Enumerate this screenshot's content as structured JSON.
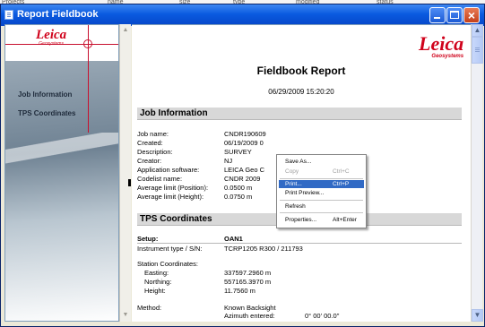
{
  "background_window": {
    "texts": [
      "Projects",
      "name",
      "size",
      "type",
      "modified",
      "status"
    ]
  },
  "window": {
    "title": "Report Fieldbook"
  },
  "left_pane": {
    "logo": {
      "word": "Leica",
      "sub": "Geosystems"
    },
    "links": [
      "Job Information",
      "TPS Coordinates"
    ]
  },
  "report": {
    "logo": {
      "word": "Leica",
      "sub": "Geosystems"
    },
    "title": "Fieldbook Report",
    "datetime": "06/29/2009 15:20:20",
    "job_section": {
      "heading": "Job Information",
      "rows": [
        {
          "label": "Job name:",
          "value": "CNDR190609"
        },
        {
          "label": "Created:",
          "value": "06/19/2009 0"
        },
        {
          "label": "Description:",
          "value": "SURVEY"
        },
        {
          "label": "Creator:",
          "value": "NJ"
        },
        {
          "label": "Application software:",
          "value": "LEICA Geo C"
        },
        {
          "label": "Codelist name:",
          "value": "CNDR 2009"
        },
        {
          "label": "Average limit (Position):",
          "value": "0.0500 m"
        },
        {
          "label": "Average limit (Height):",
          "value": "0.0750 m"
        }
      ]
    },
    "tps_section": {
      "heading": "TPS Coordinates",
      "setup_label": "Setup:",
      "setup_value": "OAN1",
      "instrument_label": "Instrument type / S/N:",
      "instrument_value": "TCRP1205 R300 / 211793",
      "station_label": "Station Coordinates:",
      "coords": [
        {
          "label": "Easting:",
          "value": "337597.2960 m"
        },
        {
          "label": "Northing:",
          "value": "557165.3970 m"
        },
        {
          "label": "Height:",
          "value": "11.7560 m"
        }
      ],
      "method_label": "Method:",
      "method_value": "Known Backsight",
      "azimuth_label": "Azimuth entered:",
      "azimuth_value": "0° 00' 00.0\""
    }
  },
  "context_menu": {
    "items": [
      {
        "label": "Save As...",
        "shortcut": "",
        "state": "normal"
      },
      {
        "label": "Copy",
        "shortcut": "Ctrl+C",
        "state": "disabled"
      },
      {
        "label": "Print...",
        "shortcut": "Ctrl+P",
        "state": "highlighted"
      },
      {
        "label": "Print Preview...",
        "shortcut": "",
        "state": "normal"
      },
      {
        "label": "Refresh",
        "shortcut": "",
        "state": "normal"
      },
      {
        "label": "Properties...",
        "shortcut": "Alt+Enter",
        "state": "normal"
      }
    ]
  },
  "colors": {
    "title_bar": "#0a5ae0",
    "leica_red": "#d0021b",
    "menu_highlight": "#316ac5",
    "section_bg": "#d8d8d8"
  }
}
